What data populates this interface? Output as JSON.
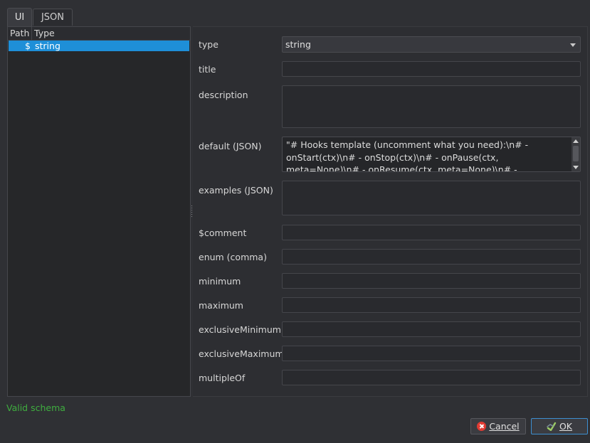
{
  "tabs": [
    {
      "label": "UI"
    },
    {
      "label": "JSON"
    }
  ],
  "tree": {
    "headers": [
      "Path",
      "Type"
    ],
    "rows": [
      {
        "path": "$",
        "type": "string"
      }
    ]
  },
  "form": {
    "type_label": "type",
    "type_value": "string",
    "title_label": "title",
    "description_label": "description",
    "default_label": "default (JSON)",
    "default_value": "\"# Hooks template (uncomment what you need):\\n# - onStart(ctx)\\n# - onStop(ctx)\\n# - onPause(ctx, meta=None)\\n# - onResume(ctx, meta=None)\\n# - onState(ctx, field, value,",
    "examples_label": "examples (JSON)",
    "comment_label": "$comment",
    "enum_label": "enum (comma)",
    "minimum_label": "minimum",
    "maximum_label": "maximum",
    "exclusive_minimum_label": "exclusiveMinimum",
    "exclusive_maximum_label": "exclusiveMaximum",
    "multiple_of_label": "multipleOf"
  },
  "status": {
    "text": "Valid schema",
    "color": "#3fae3f"
  },
  "buttons": {
    "cancel_label": "Cancel",
    "ok_label": "OK"
  },
  "icons": {
    "cancel": "cancel-icon",
    "ok": "ok-icon",
    "dropdown": "chevron-down-icon"
  },
  "colors": {
    "selection": "#1e8fd8",
    "ok_border": "#3d8fd0",
    "cancel_icon": "#e23b33"
  }
}
